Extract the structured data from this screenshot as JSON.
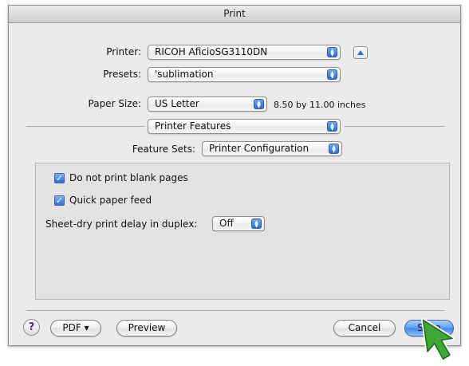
{
  "window": {
    "title": "Print"
  },
  "printer": {
    "label": "Printer:",
    "value": "RICOH AficioSG3110DN"
  },
  "presets": {
    "label": "Presets:",
    "value": "'sublimation"
  },
  "paper": {
    "label": "Paper Size:",
    "value": "US Letter",
    "dimensions": "8.50 by 11.00 inches"
  },
  "panel_select": {
    "value": "Printer Features"
  },
  "feature_sets": {
    "label": "Feature Sets:",
    "value": "Printer Configuration"
  },
  "options": {
    "blank_pages": {
      "label": "Do not print blank pages",
      "checked": true
    },
    "quick_feed": {
      "label": "Quick paper feed",
      "checked": true
    },
    "sheet_dry": {
      "label": "Sheet-dry print delay in duplex:",
      "value": "Off"
    }
  },
  "buttons": {
    "help": "?",
    "pdf": "PDF ▾",
    "preview": "Preview",
    "cancel": "Cancel",
    "save": "Save"
  },
  "colors": {
    "accent": "#3c86ea",
    "cursor": "#3fa535"
  }
}
